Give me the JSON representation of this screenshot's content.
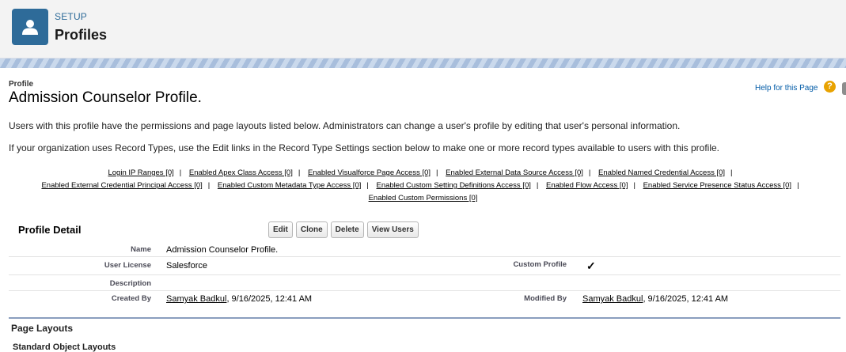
{
  "header": {
    "eyebrow": "SETUP",
    "title": "Profiles",
    "icon": "user-icon"
  },
  "page": {
    "type_label": "Profile",
    "name": "Admission Counselor Profile.",
    "help_label": "Help for this Page",
    "help_icon": "?",
    "description_1": "Users with this profile have the permissions and page layouts listed below. Administrators can change a user's profile by editing that user's personal information.",
    "description_2": "If your organization uses Record Types, use the Edit links in the Record Type Settings section below to make one or more record types available to users with this profile."
  },
  "access_links": [
    [
      "Login IP Ranges [0]",
      "Enabled Apex Class Access [0]",
      "Enabled Visualforce Page Access [0]",
      "Enabled External Data Source Access [0]",
      "Enabled Named Credential Access [0]"
    ],
    [
      "Enabled External Credential Principal Access [0]",
      "Enabled Custom Metadata Type Access [0]",
      "Enabled Custom Setting Definitions Access [0]",
      "Enabled Flow Access [0]",
      "Enabled Service Presence Status Access [0]"
    ],
    [
      "Enabled Custom Permissions [0]"
    ]
  ],
  "detail": {
    "title": "Profile Detail",
    "buttons": {
      "edit": "Edit",
      "clone": "Clone",
      "delete": "Delete",
      "view_users": "View Users"
    },
    "name_label": "Name",
    "name_value": "Admission Counselor Profile.",
    "license_label": "User License",
    "license_value": "Salesforce",
    "custom_profile_label": "Custom Profile",
    "custom_profile_value": "✓",
    "description_label": "Description",
    "description_value": "",
    "created_by_label": "Created By",
    "created_by_user": "Samyak Badkul",
    "created_by_date": ", 9/16/2025, 12:41 AM",
    "modified_by_label": "Modified By",
    "modified_by_user": "Samyak Badkul",
    "modified_by_date": ", 9/16/2025, 12:41 AM"
  },
  "page_layouts": {
    "title": "Page Layouts",
    "subheading": "Standard Object Layouts"
  }
}
